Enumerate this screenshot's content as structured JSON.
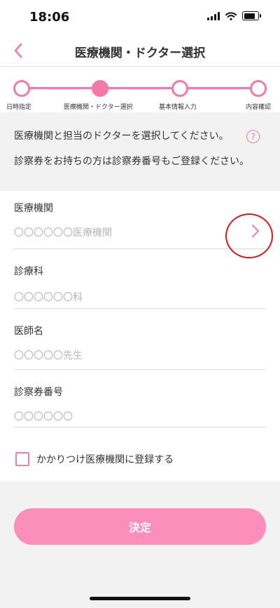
{
  "status": {
    "time": "18:06"
  },
  "nav": {
    "title": "医療機関・ドクター選択"
  },
  "steps": [
    {
      "label": "日時指定",
      "active": false
    },
    {
      "label": "医療機関・ドクター選択",
      "active": true
    },
    {
      "label": "基本情報入力",
      "active": false
    },
    {
      "label": "内容確認",
      "active": false
    }
  ],
  "intro": {
    "line1": "医療機関と担当のドクターを選択してください。",
    "help_symbol": "?",
    "line2": "診察券をお持ちの方は診察券番号もご登録ください。"
  },
  "form": {
    "institution": {
      "label": "医療機関",
      "value": "〇〇〇〇〇〇医療機関"
    },
    "department": {
      "label": "診療科",
      "value": "〇〇〇〇〇〇科"
    },
    "doctor": {
      "label": "医師名",
      "value": "〇〇〇〇〇先生"
    },
    "card_number": {
      "label": "診察券番号",
      "value": "〇〇〇〇〇〇"
    },
    "favorite_checkbox_label": "かかりつけ医療機関に登録する"
  },
  "submit_label": "決定",
  "colors": {
    "accent": "#f27aa9",
    "button": "#fb8ebb",
    "annotation": "#e0151e"
  }
}
